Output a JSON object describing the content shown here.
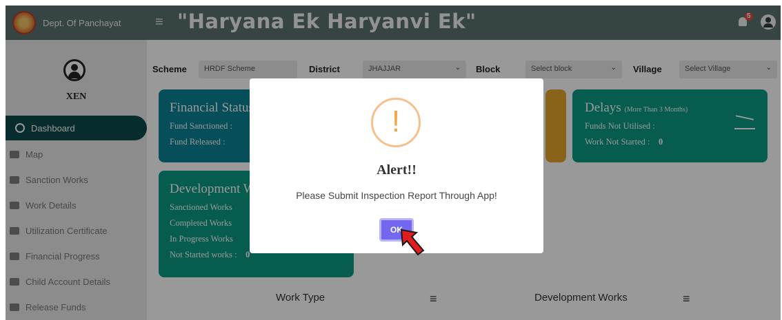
{
  "sidebar": {
    "brand": "Dept. Of Panchayat",
    "user_role": "XEN",
    "items": [
      {
        "label": "Dashboard",
        "icon": "dashboard-icon"
      },
      {
        "label": "Map",
        "icon": "map-icon"
      },
      {
        "label": "Sanction Works",
        "icon": "mail-icon"
      },
      {
        "label": "Work Details",
        "icon": "briefcase-icon"
      },
      {
        "label": "Utilization Certificate",
        "icon": "certificate-icon"
      },
      {
        "label": "Financial Progress",
        "icon": "document-icon"
      },
      {
        "label": "Child Account Details",
        "icon": "account-icon"
      },
      {
        "label": "Release Funds",
        "icon": "funds-icon"
      }
    ]
  },
  "header": {
    "title": "\"Haryana Ek Haryanvi Ek\"",
    "notification_count": "5"
  },
  "filters": {
    "scheme_label": "Scheme",
    "scheme_value": "HRDF Scheme",
    "district_label": "District",
    "district_value": "JHAJJAR",
    "block_label": "Block",
    "block_value": "Select block",
    "village_label": "Village",
    "village_value": "Select Village"
  },
  "cards": {
    "financial": {
      "title": "Financial Status",
      "fund_sanctioned": "Fund Sanctioned :",
      "fund_released": "Fund Released :"
    },
    "delays": {
      "title": "Delays",
      "subtitle": "(More Than 3 Months)",
      "funds_not_utilised": "Funds Not Utilised :",
      "work_not_started": "Work Not Started :",
      "work_not_started_value": "0"
    },
    "development": {
      "title": "Development Works",
      "sanctioned": "Sanctioned Works",
      "completed": "Completed Works",
      "in_progress": "In Progress Works",
      "not_started": "Not Started works :",
      "not_started_value": "0"
    }
  },
  "sections": {
    "work_type": "Work Type",
    "development_works": "Development Works"
  },
  "modal": {
    "icon": "!",
    "title": "Alert!!",
    "message": "Please Submit Inspection Report Through App!",
    "ok_label": "OK"
  },
  "colors": {
    "header_bg": "#5a7270",
    "active_nav": "#0d4a4e",
    "financial_card": "#0a8394",
    "delay_card": "#0d9a86",
    "warning_card": "#e4a52a",
    "ok_button": "#7367f0",
    "pointer_arrow": "#e11d1d"
  }
}
